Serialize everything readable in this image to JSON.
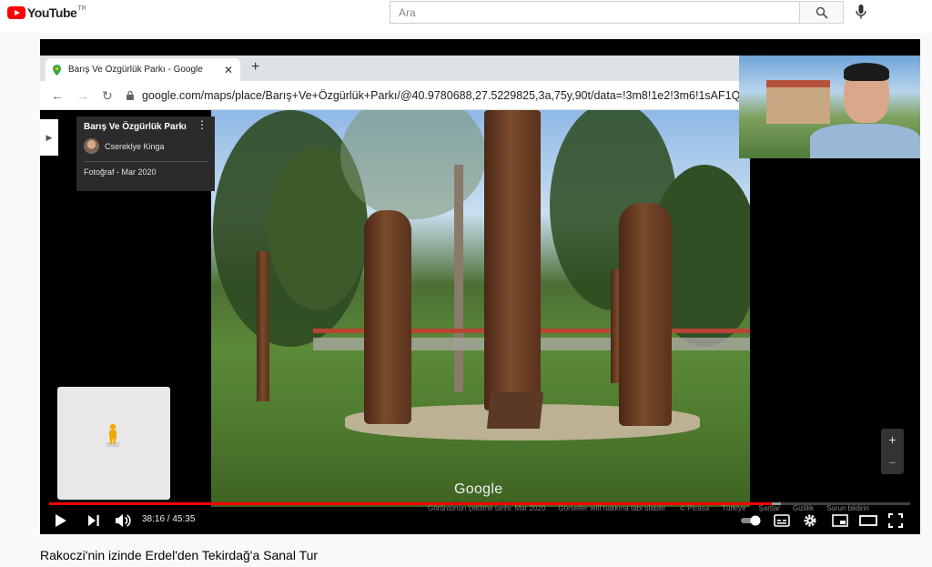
{
  "masthead": {
    "logo_text": "YouTube",
    "country_code": "TR",
    "search_placeholder": "Ara"
  },
  "browser": {
    "tab_title": "Barış Ve Özgürlük Parkı - Google",
    "url": "google.com/maps/place/Barış+Ve+Özgürlük+Parkı/@40.9780688,27.5229825,3a,75y,90t/data=!3m8!1e2!3m6!1sAF1Q"
  },
  "streetview": {
    "place_name": "Barış Ve Özgürlük Parkı",
    "author": "Csereklye Kinga",
    "photo_date": "Fotoğraf - Mar 2020",
    "watermark": "Google",
    "footer": [
      "Görüntünün çekilme tarihi: Mar 2020",
      "Görseller telif hakkına tabi olabilir.",
      "© Picasa",
      "Türkiye",
      "Şartlar",
      "Gizlilik",
      "Sorun bildirin"
    ]
  },
  "player": {
    "current_time": "38:16",
    "duration": "45:35",
    "time_display": "38:16 / 45:35",
    "played_fraction": 0.8395,
    "loaded_fraction": 0.85
  },
  "video": {
    "title": "Rakoczi'nin izinde Erdel'den Tekirdağ'a Sanal Tur"
  },
  "colors": {
    "brand_red": "#ff0000",
    "progress_red": "#ff0000"
  }
}
